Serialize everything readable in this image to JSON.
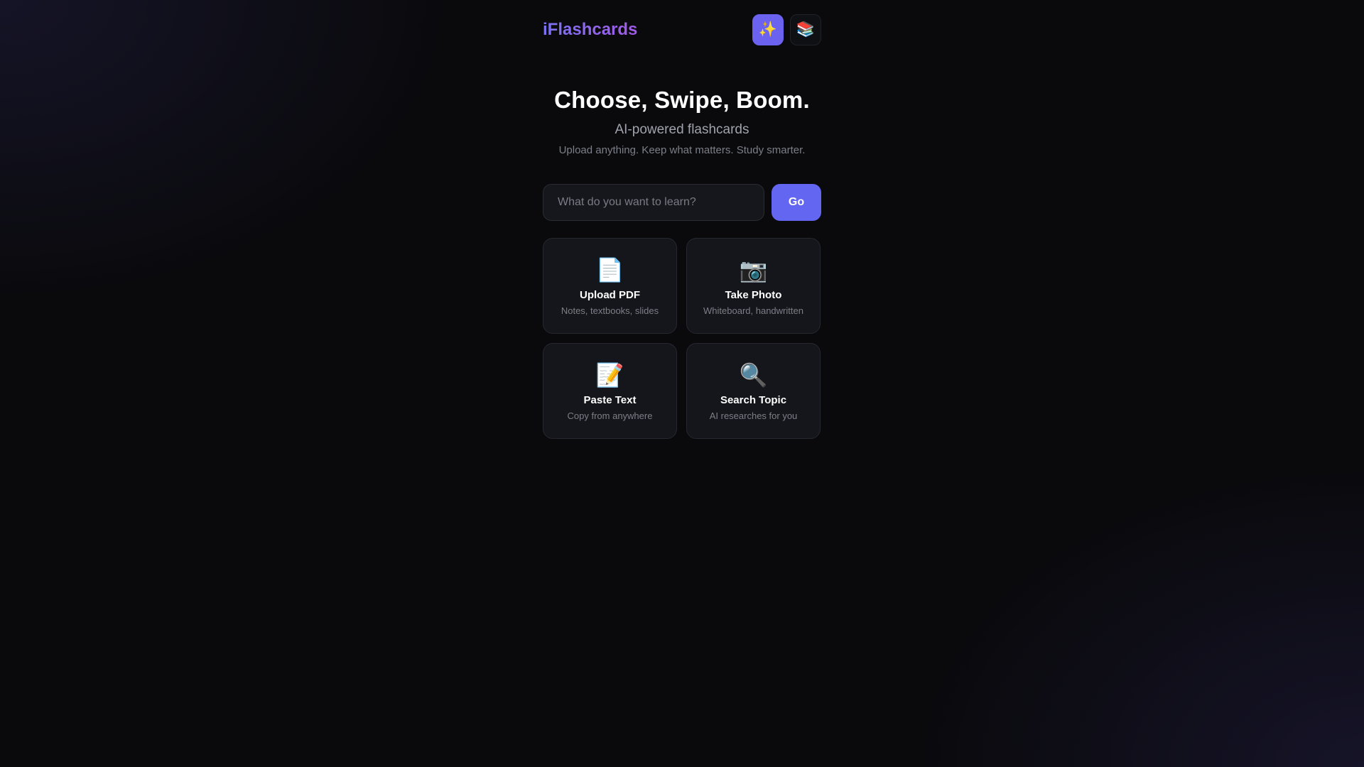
{
  "header": {
    "brand": "iFlashcards",
    "actions": [
      {
        "icon": "sparkles-icon",
        "glyph": "✨",
        "active": true
      },
      {
        "icon": "books-icon",
        "glyph": "📚",
        "active": false
      }
    ]
  },
  "hero": {
    "title": "Choose, Swipe, Boom.",
    "subtitle": "AI-powered flashcards",
    "tagline": "Upload anything. Keep what matters. Study smarter."
  },
  "search": {
    "placeholder": "What do you want to learn?",
    "value": "",
    "go_label": "Go"
  },
  "cards": [
    {
      "icon": "document-icon",
      "glyph": "📄",
      "title": "Upload PDF",
      "desc": "Notes, textbooks, slides"
    },
    {
      "icon": "camera-icon",
      "glyph": "📷",
      "title": "Take Photo",
      "desc": "Whiteboard, handwritten"
    },
    {
      "icon": "memo-icon",
      "glyph": "📝",
      "title": "Paste Text",
      "desc": "Copy from anywhere"
    },
    {
      "icon": "magnifier-icon",
      "glyph": "🔍",
      "title": "Search Topic",
      "desc": "AI researches for you"
    }
  ],
  "colors": {
    "accent": "#6366f1",
    "background": "#0a0a0d",
    "card": "#15161b"
  }
}
